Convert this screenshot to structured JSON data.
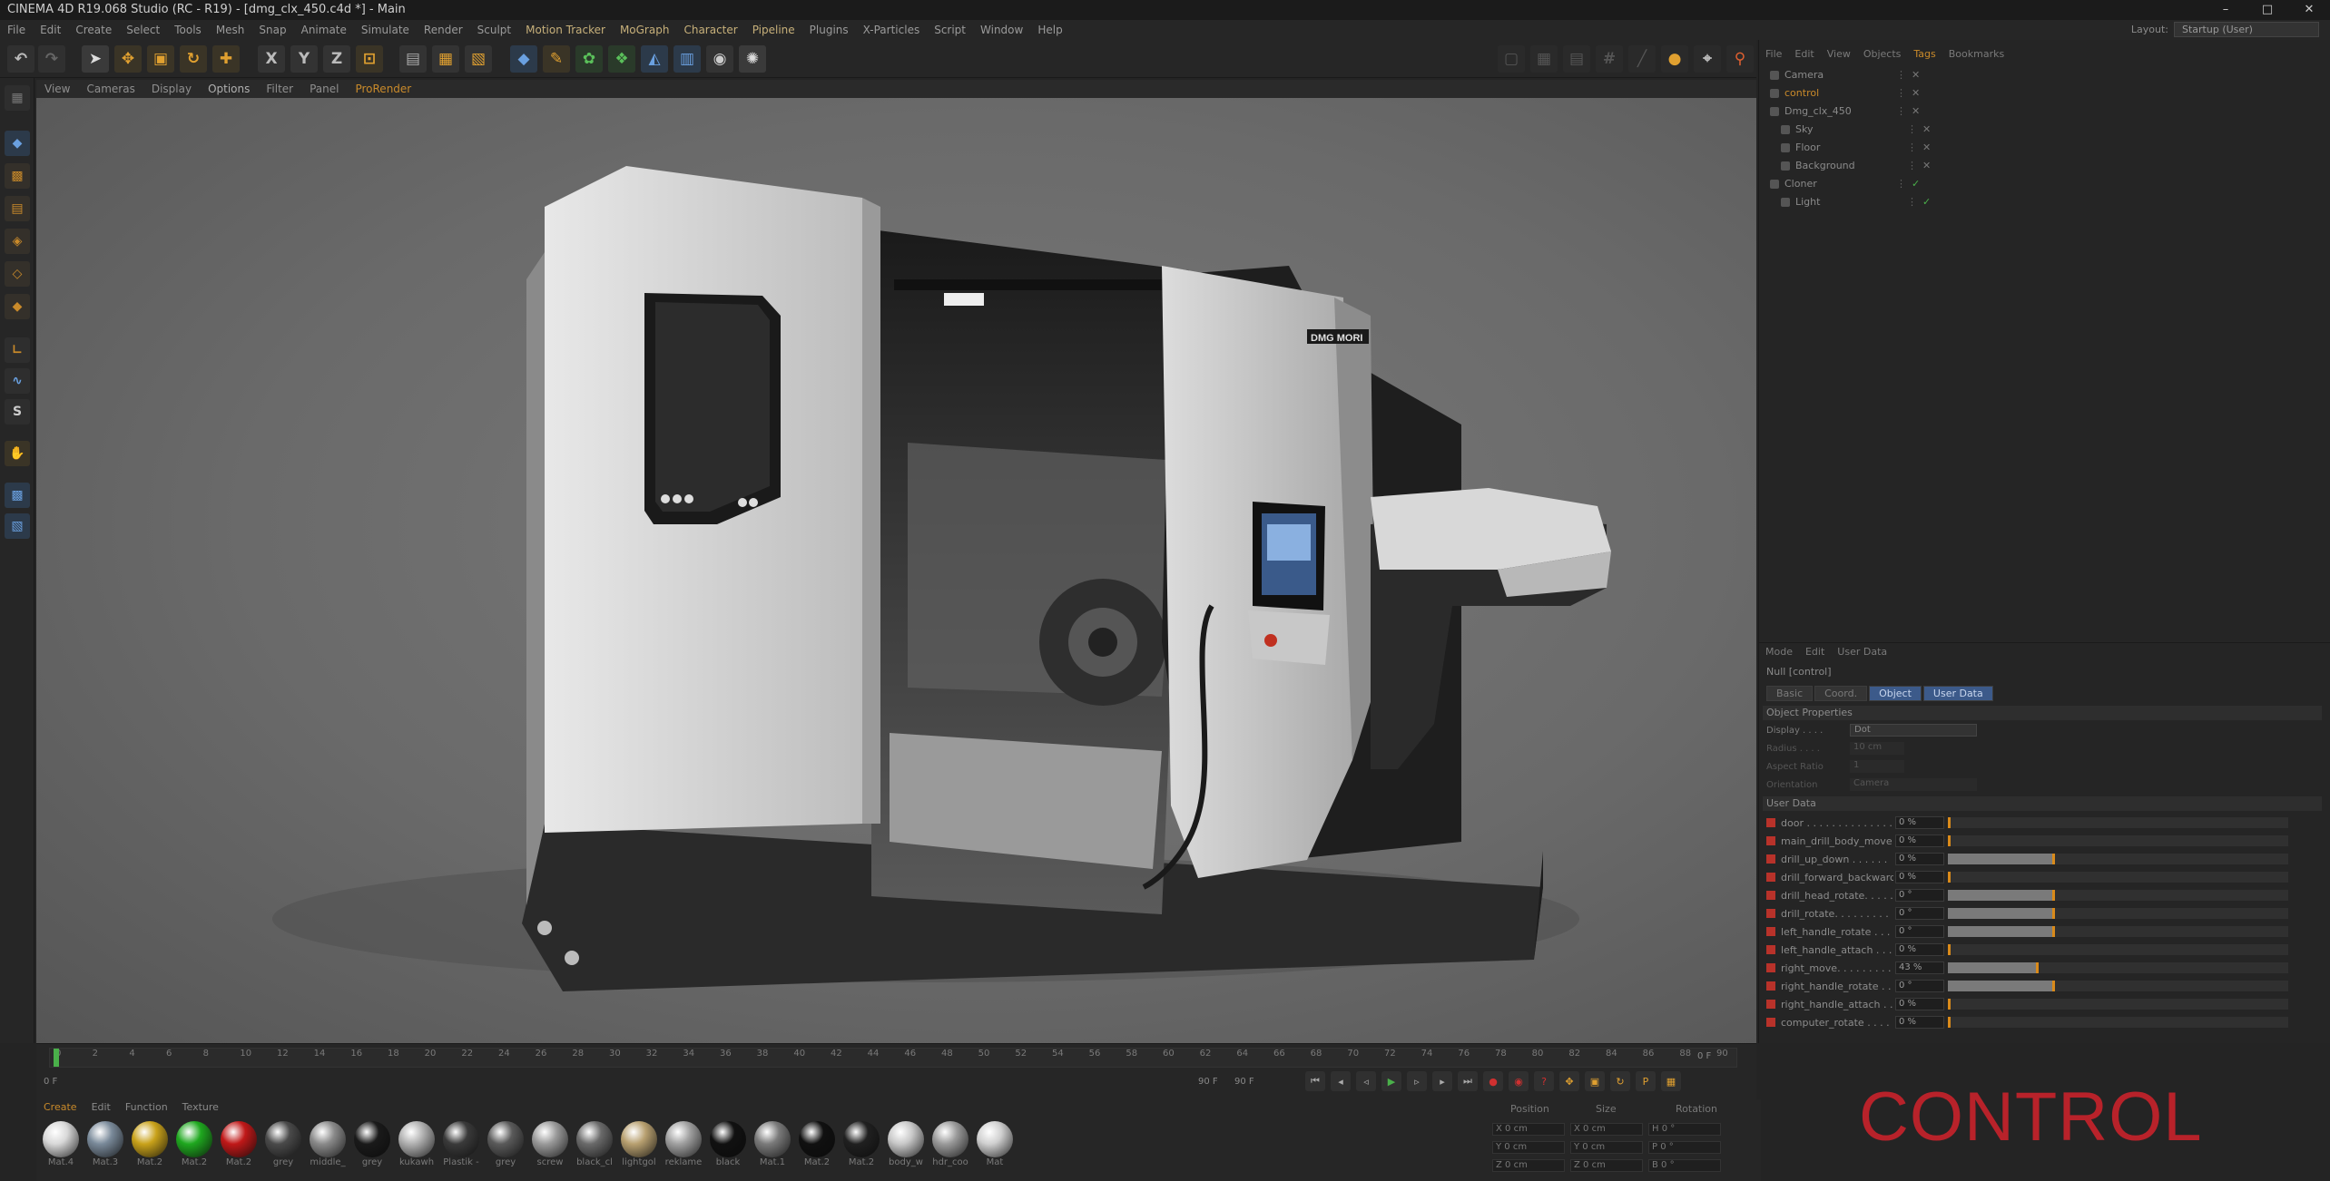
{
  "title": "CINEMA 4D R19.068 Studio (RC - R19) - [dmg_clx_450.c4d *] - Main",
  "window_buttons": [
    "–",
    "□",
    "✕"
  ],
  "menu": [
    "File",
    "Edit",
    "Create",
    "Select",
    "Tools",
    "Mesh",
    "Snap",
    "Animate",
    "Simulate",
    "Render",
    "Sculpt",
    "Motion Tracker",
    "MoGraph",
    "Character",
    "Pipeline",
    "Plugins",
    "X-Particles",
    "Script",
    "Window",
    "Help"
  ],
  "layout": {
    "label": "Layout:",
    "value": "Startup (User)"
  },
  "axis_buttons": [
    "X",
    "Y",
    "Z"
  ],
  "viewport_menu": [
    "View",
    "Cameras",
    "Display",
    "Options",
    "Filter",
    "Panel",
    "ProRender"
  ],
  "machine_brand": "DMG MORI",
  "object_menu": [
    "File",
    "Edit",
    "View",
    "Objects",
    "Tags",
    "Bookmarks"
  ],
  "objects": [
    {
      "name": "Camera"
    },
    {
      "name": "control"
    },
    {
      "name": "Dmg_clx_450"
    },
    {
      "name": "Sky"
    },
    {
      "name": "Floor"
    },
    {
      "name": "Background"
    },
    {
      "name": "Cloner"
    },
    {
      "name": "Light"
    }
  ],
  "attr_menu": [
    "Mode",
    "Edit",
    "User Data"
  ],
  "attr_title": "Null [control]",
  "attr_tabs": [
    "Basic",
    "Coord.",
    "Object",
    "User Data"
  ],
  "object_properties": {
    "header": "Object Properties",
    "display_label": "Display . . . .",
    "display_value": "Dot",
    "radius_label": "Radius . . . .",
    "radius_value": "10 cm",
    "aspect_label": "Aspect Ratio",
    "aspect_value": "1",
    "orient_label": "Orientation",
    "orient_value": "Camera"
  },
  "user_data_header": "User Data",
  "user_data": [
    {
      "label": "door . . . . . . . . . . . . . . .",
      "value": "0 %",
      "fill": 0.0
    },
    {
      "label": "main_drill_body_move",
      "value": "0 %",
      "fill": 0.0
    },
    {
      "label": "drill_up_down . . . . . .",
      "value": "0 %",
      "fill": 0.31
    },
    {
      "label": "drill_forward_backward",
      "value": "0 %",
      "fill": 0.0
    },
    {
      "label": "drill_head_rotate. . . . .",
      "value": "0 °",
      "fill": 0.31
    },
    {
      "label": "drill_rotate. . . . . . . . .",
      "value": "0 °",
      "fill": 0.31
    },
    {
      "label": "left_handle_rotate . . .",
      "value": "0 °",
      "fill": 0.31
    },
    {
      "label": "left_handle_attach . . .",
      "value": "0 %",
      "fill": 0.0
    },
    {
      "label": "right_move. . . . . . . . .",
      "value": "43 %",
      "fill": 0.26
    },
    {
      "label": "right_handle_rotate . . .",
      "value": "0 °",
      "fill": 0.31
    },
    {
      "label": "right_handle_attach . . .",
      "value": "0 %",
      "fill": 0.0
    },
    {
      "label": "computer_rotate . . . . .",
      "value": "0 %",
      "fill": 0.0
    }
  ],
  "timeline": {
    "ticks": [
      "0",
      "2",
      "4",
      "6",
      "8",
      "10",
      "12",
      "14",
      "16",
      "18",
      "20",
      "22",
      "24",
      "26",
      "28",
      "30",
      "32",
      "34",
      "36",
      "38",
      "40",
      "42",
      "44",
      "46",
      "48",
      "50",
      "52",
      "54",
      "56",
      "58",
      "60",
      "62",
      "64",
      "66",
      "68",
      "70",
      "72",
      "74",
      "76",
      "78",
      "80",
      "82",
      "84",
      "86",
      "88",
      "90"
    ],
    "current": "0 F",
    "start": "0 F",
    "end": "90 F",
    "end2": "90 F",
    "right_frame": "0 F"
  },
  "material_menu": [
    "Create",
    "Edit",
    "Function",
    "Texture"
  ],
  "materials": [
    {
      "name": "Mat.4",
      "color": "#d8d8d8"
    },
    {
      "name": "Mat.3",
      "color": "#7a8a9a"
    },
    {
      "name": "Mat.2",
      "color": "#c9a21a"
    },
    {
      "name": "Mat.2",
      "color": "#1fa81f"
    },
    {
      "name": "Mat.2",
      "color": "#c01818"
    },
    {
      "name": "grey",
      "color": "#4a4a4a"
    },
    {
      "name": "middle_",
      "color": "#8a8a8a"
    },
    {
      "name": "grey",
      "color": "#1a1a1a"
    },
    {
      "name": "kukawh",
      "color": "#b0b0b0"
    },
    {
      "name": "Plastik -",
      "color": "#3a3a3a"
    },
    {
      "name": "grey",
      "color": "#5a5a5a"
    },
    {
      "name": "screw",
      "color": "#9a9a9a"
    },
    {
      "name": "black_cl",
      "color": "#6a6a6a"
    },
    {
      "name": "lightgol",
      "color": "#b8a070"
    },
    {
      "name": "reklame",
      "color": "#a0a0a0"
    },
    {
      "name": "black",
      "color": "#111111"
    },
    {
      "name": "Mat.1",
      "color": "#7a7a7a"
    },
    {
      "name": "Mat.2",
      "color": "#101010"
    },
    {
      "name": "Mat.2",
      "color": "#202020"
    },
    {
      "name": "body_w",
      "color": "#c8c8c8"
    },
    {
      "name": "hdr_coo",
      "color": "#9a9a9a"
    },
    {
      "name": "Mat",
      "color": "#d0d0d0"
    }
  ],
  "coords": {
    "headers": [
      "Position",
      "Size",
      "Rotation"
    ],
    "rows": [
      [
        "X  0 cm",
        "X  0 cm",
        "H  0 °"
      ],
      [
        "Y  0 cm",
        "Y  0 cm",
        "P  0 °"
      ],
      [
        "Z  0 cm",
        "Z  0 cm",
        "B  0 °"
      ]
    ]
  },
  "overlay_label": "CONTROL",
  "colors": {
    "accent": "#c98a2a",
    "overlay": "#b8222a",
    "tab_active": "#3c5a8a"
  }
}
